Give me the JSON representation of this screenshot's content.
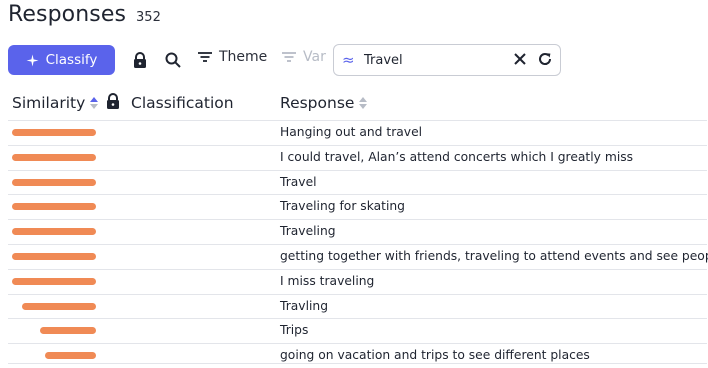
{
  "header": {
    "title": "Responses",
    "count": "352"
  },
  "toolbar": {
    "classify_label": "Classify",
    "theme_label": "Theme",
    "var_label": "Var",
    "search_value": "Travel"
  },
  "columns": {
    "similarity": "Similarity",
    "classification": "Classification",
    "response": "Response"
  },
  "rows": [
    {
      "similarity": 1.0,
      "response": "Hanging out and travel"
    },
    {
      "similarity": 1.0,
      "response": "I could travel, Alan’s attend concerts which I greatly miss"
    },
    {
      "similarity": 1.0,
      "response": "Travel"
    },
    {
      "similarity": 1.0,
      "response": "Traveling for skating"
    },
    {
      "similarity": 1.0,
      "response": "Traveling"
    },
    {
      "similarity": 1.0,
      "response": "getting together with friends, traveling to attend events and see people"
    },
    {
      "similarity": 1.0,
      "response": "I miss traveling"
    },
    {
      "similarity": 0.88,
      "response": "Travling"
    },
    {
      "similarity": 0.67,
      "response": "Trips"
    },
    {
      "similarity": 0.61,
      "response": "going on vacation and trips to see different places"
    }
  ],
  "colors": {
    "accent": "#5a63eb",
    "bar": "#f08a55"
  },
  "icons": [
    "sparkle-icon",
    "lock-icon",
    "search-icon",
    "filter-icon",
    "approx-icon",
    "close-icon",
    "refresh-icon",
    "sort-icon"
  ]
}
